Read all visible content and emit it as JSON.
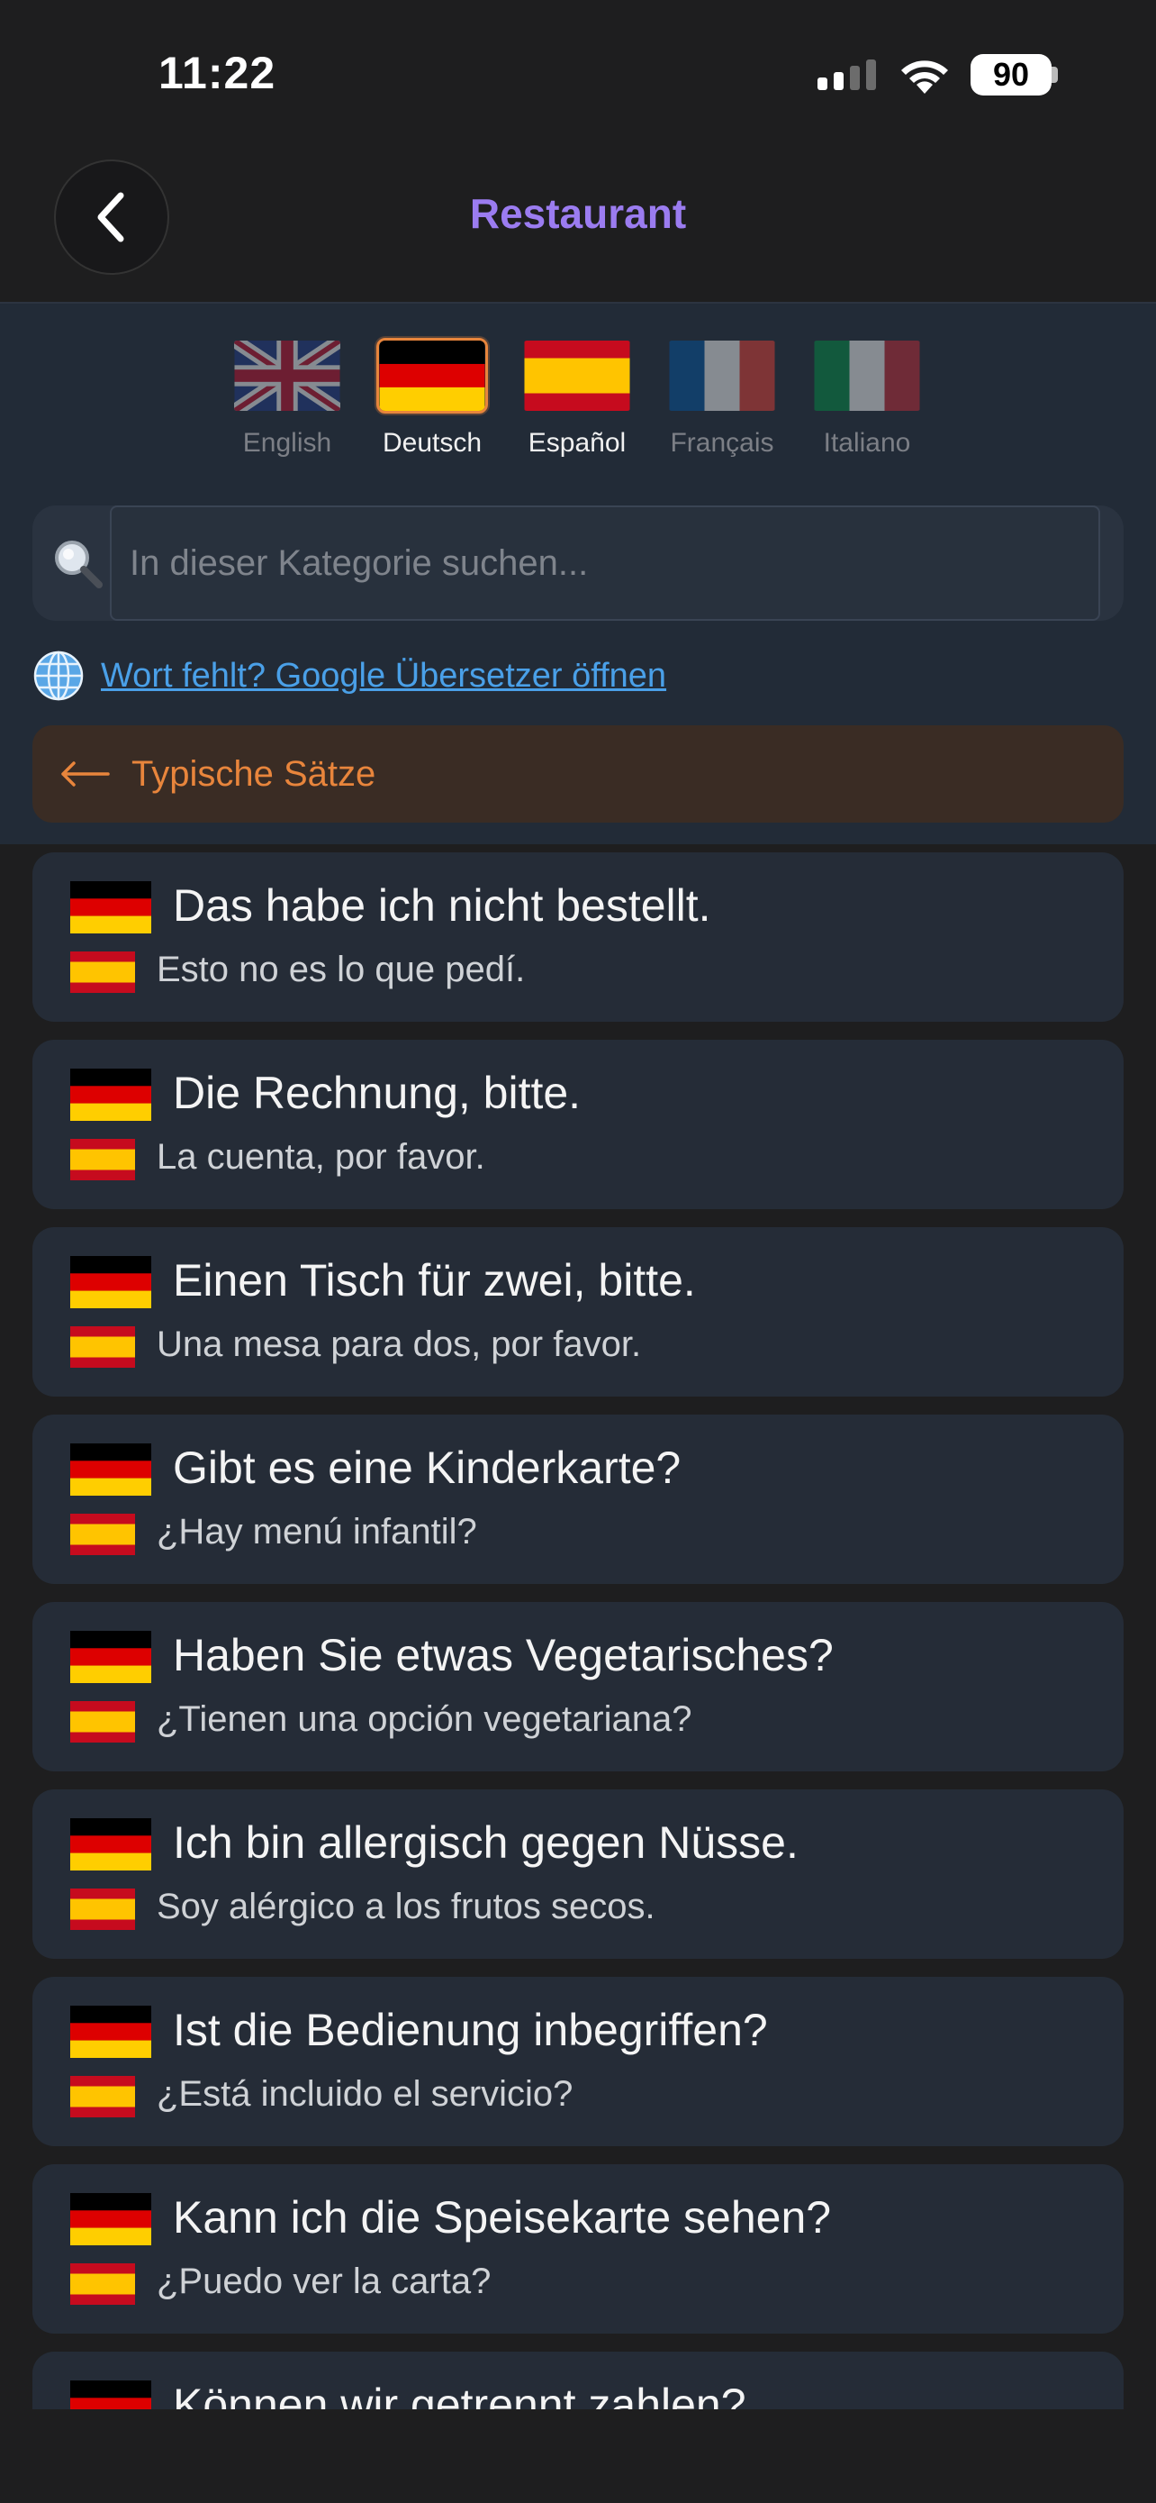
{
  "status_bar": {
    "time": "11:22",
    "battery": "90"
  },
  "header": {
    "title": "Restaurant"
  },
  "languages": [
    {
      "label": "English",
      "state": "off"
    },
    {
      "label": "Deutsch",
      "state": "active"
    },
    {
      "label": "Español",
      "state": "on"
    },
    {
      "label": "Français",
      "state": "off"
    },
    {
      "label": "Italiano",
      "state": "off"
    }
  ],
  "search": {
    "placeholder": "In dieser Kategorie suchen..."
  },
  "translate_link": "Wort fehlt? Google Übersetzer öffnen",
  "category_back": {
    "label": "Typische Sätze"
  },
  "phrases": [
    {
      "de": "Das habe ich nicht bestellt.",
      "es": "Esto no es lo que pedí."
    },
    {
      "de": "Die Rechnung, bitte.",
      "es": "La cuenta, por favor."
    },
    {
      "de": "Einen Tisch für zwei, bitte.",
      "es": "Una mesa para dos, por favor."
    },
    {
      "de": "Gibt es eine Kinderkarte?",
      "es": "¿Hay menú infantil?"
    },
    {
      "de": "Haben Sie etwas Vegetarisches?",
      "es": "¿Tienen una opción vegetariana?"
    },
    {
      "de": "Ich bin allergisch gegen Nüsse.",
      "es": "Soy alérgico a los frutos secos."
    },
    {
      "de": "Ist die Bedienung inbegriffen?",
      "es": "¿Está incluido el servicio?"
    },
    {
      "de": "Kann ich die Speisekarte sehen?",
      "es": "¿Puedo ver la carta?"
    },
    {
      "de": "Können wir getrennt zahlen?",
      "es": ""
    }
  ],
  "colors": {
    "accent_purple": "#9b7cf0",
    "accent_orange": "#e8853c",
    "link_blue": "#4aa0e8"
  }
}
